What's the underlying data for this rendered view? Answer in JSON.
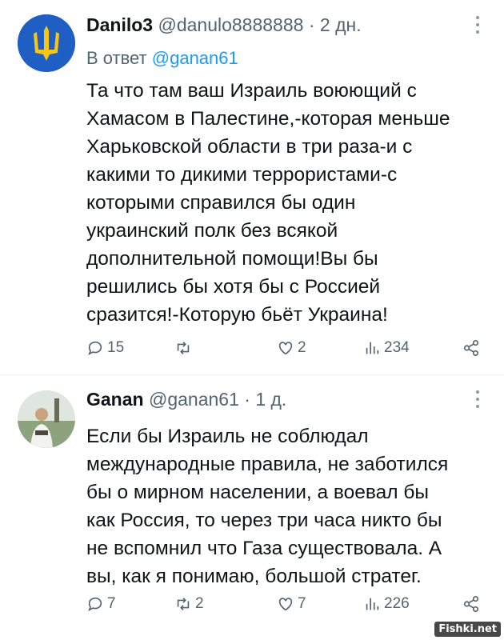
{
  "tweets": [
    {
      "author_name": "Danilo3",
      "handle": "@danulo8888888",
      "separator": "·",
      "time": "2 дн.",
      "reply_prefix": "В ответ",
      "reply_mention": "@ganan61",
      "text_lines": [
        "Та что там ваш Израиль воюющий с",
        "Хамасом в Палестине,-которая меньше",
        "Харьковской области в три раза-и с",
        "какими то дикими террористами-с",
        "которыми справился бы один",
        "украинский полк без всякой",
        "дополнительной помощи!Вы бы",
        "решились бы хотя бы с Россией",
        "сразится!-Которую бьёт Украина!"
      ],
      "stats": {
        "replies": "15",
        "retweets": "",
        "likes": "2",
        "views": "234"
      },
      "avatar_icon": "ukraine-trident-icon"
    },
    {
      "author_name": "Ganan",
      "handle": "@ganan61",
      "separator": "·",
      "time": "1 д.",
      "text_lines": [
        "Если бы Израиль не соблюдал",
        "международные правила, не заботился",
        "бы о мирном населении, а воевал бы",
        "как Россия, то через три часа никто бы",
        "не вспомнил что Газа существовала. А",
        "вы, как я понимаю, большой стратег."
      ],
      "stats": {
        "replies": "7",
        "retweets": "2",
        "likes": "7",
        "views": "226"
      },
      "avatar_icon": "user-photo-icon"
    }
  ],
  "watermark": "Fishki.net",
  "colors": {
    "text": "#0f1419",
    "secondary": "#536471",
    "link": "#1d9bf0",
    "trident_bg": "#1f5fc4",
    "trident_gold": "#f5c518"
  }
}
